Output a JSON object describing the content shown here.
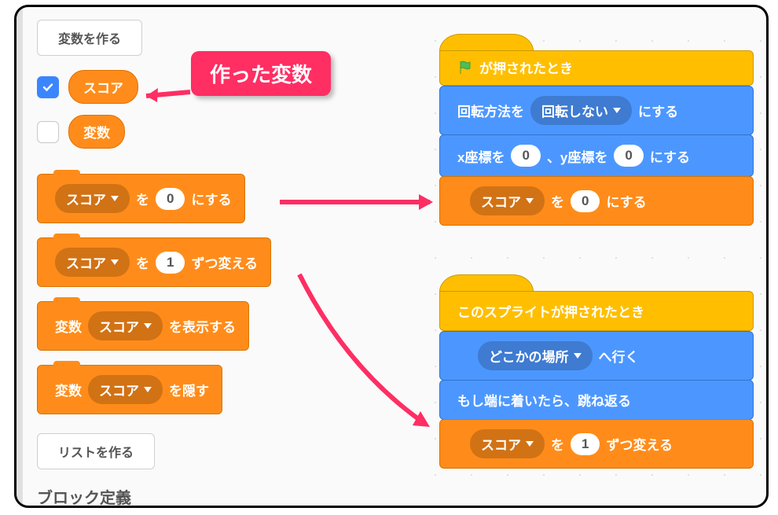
{
  "buttons": {
    "make_variable": "変数を作る",
    "make_list": "リストを作る"
  },
  "callout": "作った変数",
  "variables": {
    "score_label": "スコア",
    "var_label": "変数"
  },
  "palette": {
    "set_var": {
      "dropdown": "スコア",
      "mid": "を",
      "value": "0",
      "suffix": "にする"
    },
    "change_var": {
      "dropdown": "スコア",
      "mid": "を",
      "value": "1",
      "suffix": "ずつ変える"
    },
    "show_var": {
      "prefix": "変数",
      "dropdown": "スコア",
      "suffix": "を表示する"
    },
    "hide_var": {
      "prefix": "変数",
      "dropdown": "スコア",
      "suffix": "を隠す"
    }
  },
  "stack1": {
    "hat": "が押されたとき",
    "rotation": {
      "prefix": "回転方法を",
      "dropdown": "回転しない",
      "suffix": "にする"
    },
    "goto": {
      "p1": "x座標を",
      "v1": "0",
      "p2": "、y座標を",
      "v2": "0",
      "suffix": "にする"
    },
    "setscore": {
      "dropdown": "スコア",
      "mid": "を",
      "value": "0",
      "suffix": "にする"
    }
  },
  "stack2": {
    "hat": "このスプライトが押されたとき",
    "goto_random": {
      "dropdown": "どこかの場所",
      "suffix": "へ行く"
    },
    "bounce": "もし端に着いたら、跳ね返る",
    "change": {
      "dropdown": "スコア",
      "mid": "を",
      "value": "1",
      "suffix": "ずつ変える"
    }
  },
  "section": "ブロック定義"
}
